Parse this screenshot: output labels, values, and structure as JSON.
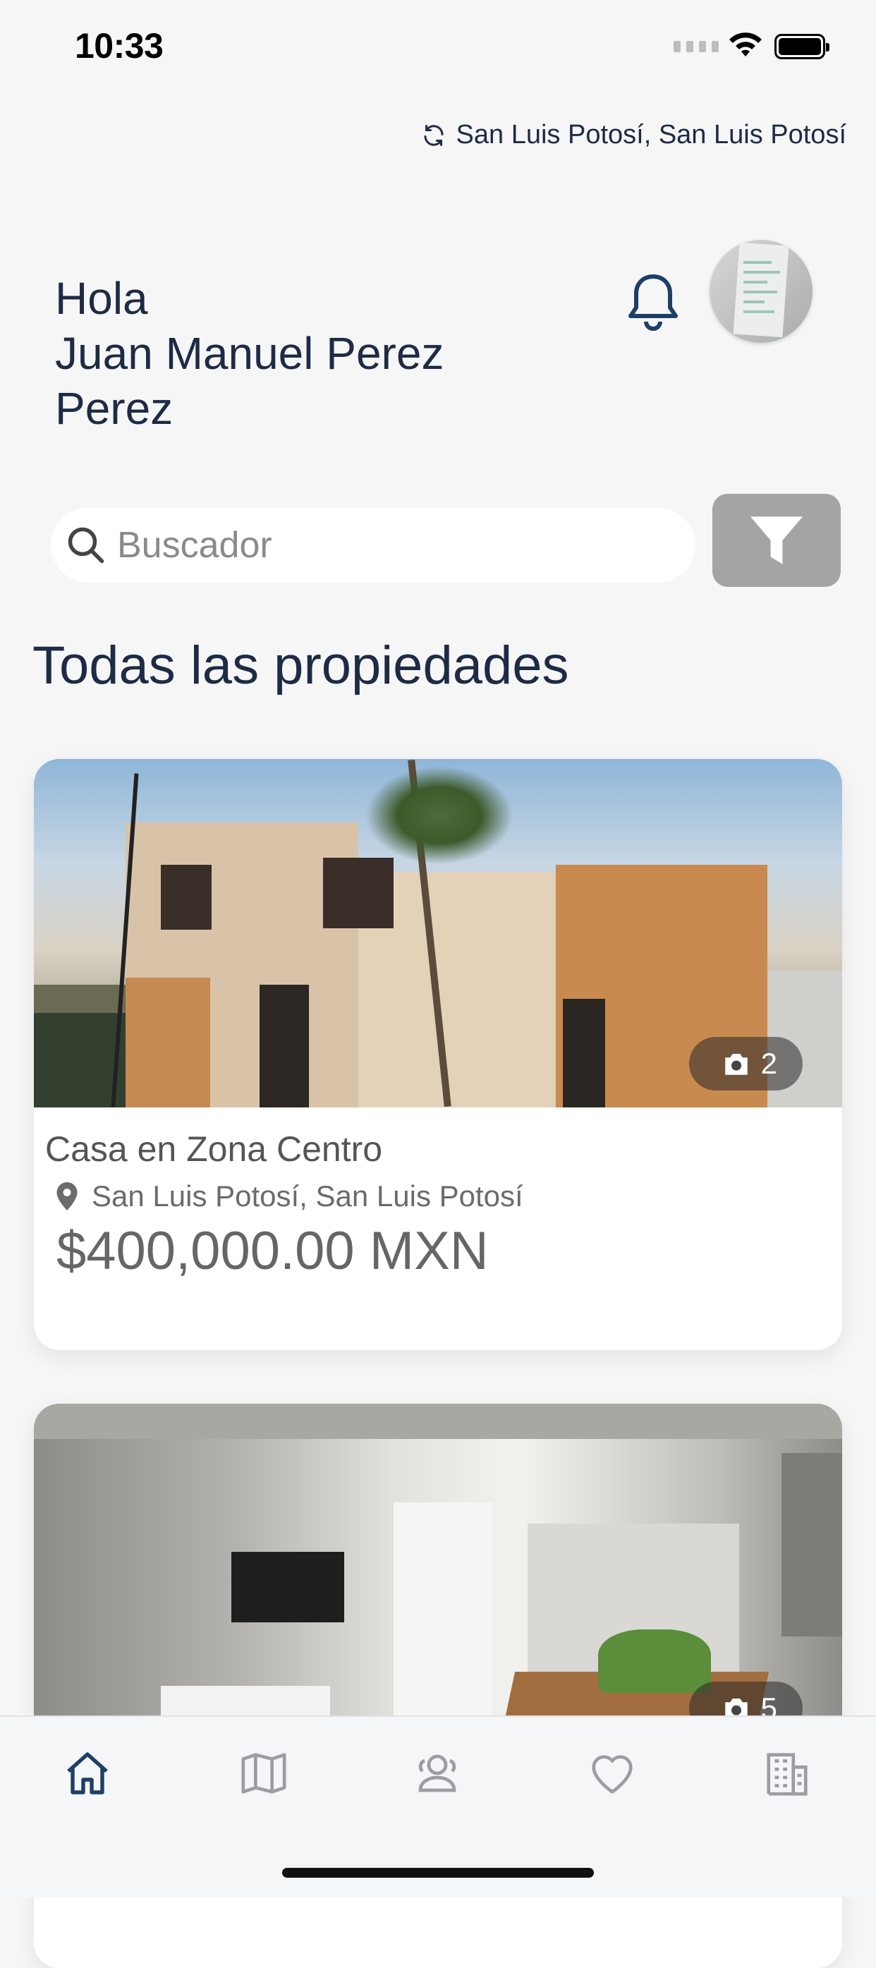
{
  "status_bar": {
    "time": "10:33"
  },
  "location": {
    "text": "San Luis Potosí, San Luis Potosí",
    "icon": "refresh-icon"
  },
  "greeting": {
    "line1": "Hola",
    "line2": "Juan Manuel Perez",
    "line3": "Perez"
  },
  "header": {
    "notification_icon": "bell-icon",
    "avatar": "user-avatar"
  },
  "search": {
    "placeholder": "Buscador",
    "icon": "search-icon",
    "filter_icon": "filter-icon"
  },
  "section_title": "Todas las propiedades",
  "properties": [
    {
      "title": "Casa en Zona Centro",
      "location": "San Luis Potosí, San Luis Potosí",
      "price": "$400,000.00 MXN",
      "photo_count": "2"
    },
    {
      "photo_count": "5"
    }
  ],
  "tabbar": {
    "items": [
      {
        "icon": "home-icon",
        "active": true
      },
      {
        "icon": "map-icon",
        "active": false
      },
      {
        "icon": "users-icon",
        "active": false
      },
      {
        "icon": "heart-icon",
        "active": false
      },
      {
        "icon": "building-icon",
        "active": false
      }
    ]
  },
  "colors": {
    "primary": "#1d2b45",
    "inactive_icon": "#9a9da3",
    "filter_button": "#a4a4a4",
    "background": "#f6f6f7"
  }
}
